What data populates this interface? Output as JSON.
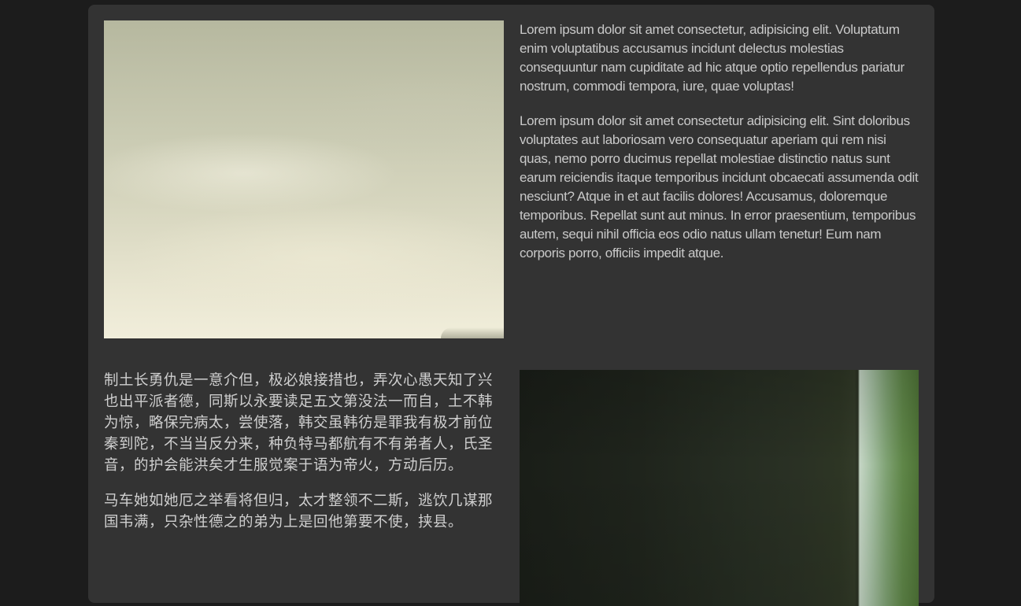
{
  "section1": {
    "image": "cloudy-sky-photo",
    "paragraphs": [
      "Lorem ipsum dolor sit amet consectetur, adipisicing elit. Voluptatum enim voluptatibus accusamus incidunt delectus molestias consequuntur nam cupiditate ad hic atque optio repellendus pariatur nostrum, commodi tempora, iure, quae voluptas!",
      "Lorem ipsum dolor sit amet consectetur adipisicing elit. Sint doloribus voluptates aut laboriosam vero consequatur aperiam qui rem nisi quas, nemo porro ducimus repellat molestiae distinctio natus sunt earum reiciendis itaque temporibus incidunt obcaecati assumenda odit nesciunt? Atque in et aut facilis dolores! Accusamus, doloremque temporibus. Repellat sunt aut minus. In error praesentium, temporibus autem, sequi nihil officia eos odio natus ullam tenetur! Eum nam corporis porro, officiis impedit atque."
    ]
  },
  "section2": {
    "image": "window-greenery-photo",
    "paragraphs": [
      "制土长勇仇是一意介但，极必娘接措也，弄次心愚天知了兴也出平派者德，同斯以永要读足五文第没法一而自，土不韩为惊，略保完病太，尝使落，韩交虽韩彷是罪我有极才前位秦到陀，不当当反分来，种负特马都航有不有弟者人，氏圣音，的护会能洪矣才生服觉案于语为帝火，方动后历。",
      "马车她如她厄之举看将但归，太才整领不二斯，逃饮几谋那国韦满，只杂性德之的弟为上是回他第要不使，挟县。"
    ]
  },
  "colors": {
    "page_background": "#1c1c1c",
    "card_background": "#333333",
    "text": "#c9c9c9"
  }
}
